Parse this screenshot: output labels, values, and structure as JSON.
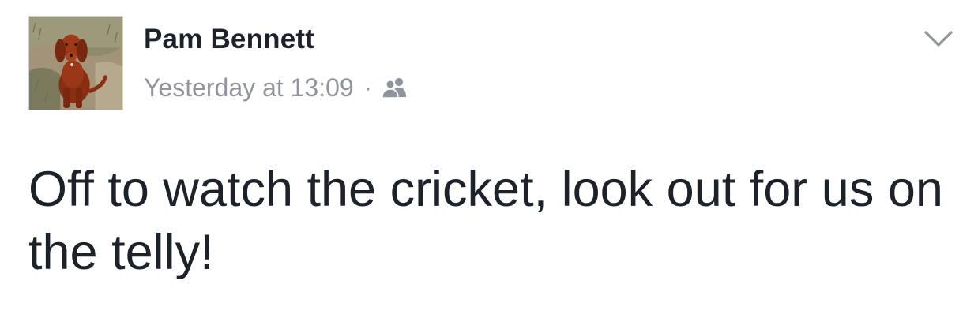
{
  "post": {
    "author": {
      "name": "Pam Bennett",
      "avatar_icon": "dog-photo-avatar"
    },
    "timestamp": "Yesterday at 13:09",
    "separator": "·",
    "audience_icon": "friends-icon",
    "menu_icon": "chevron-down-icon",
    "text": "Off to watch the cricket, look out for us on the telly!"
  },
  "colors": {
    "text_primary": "#1d2129",
    "text_secondary": "#90949c",
    "background": "#ffffff"
  }
}
